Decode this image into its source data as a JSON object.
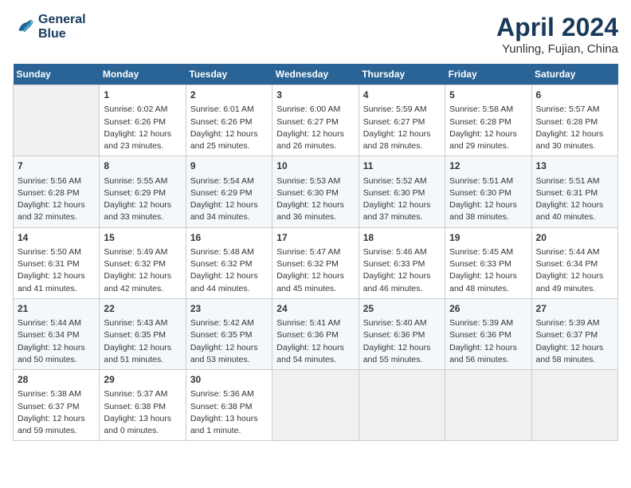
{
  "header": {
    "logo_line1": "General",
    "logo_line2": "Blue",
    "month": "April 2024",
    "location": "Yunling, Fujian, China"
  },
  "days_of_week": [
    "Sunday",
    "Monday",
    "Tuesday",
    "Wednesday",
    "Thursday",
    "Friday",
    "Saturday"
  ],
  "weeks": [
    [
      {
        "day": "",
        "empty": true
      },
      {
        "day": "1",
        "sunrise": "Sunrise: 6:02 AM",
        "sunset": "Sunset: 6:26 PM",
        "daylight": "Daylight: 12 hours and 23 minutes."
      },
      {
        "day": "2",
        "sunrise": "Sunrise: 6:01 AM",
        "sunset": "Sunset: 6:26 PM",
        "daylight": "Daylight: 12 hours and 25 minutes."
      },
      {
        "day": "3",
        "sunrise": "Sunrise: 6:00 AM",
        "sunset": "Sunset: 6:27 PM",
        "daylight": "Daylight: 12 hours and 26 minutes."
      },
      {
        "day": "4",
        "sunrise": "Sunrise: 5:59 AM",
        "sunset": "Sunset: 6:27 PM",
        "daylight": "Daylight: 12 hours and 28 minutes."
      },
      {
        "day": "5",
        "sunrise": "Sunrise: 5:58 AM",
        "sunset": "Sunset: 6:28 PM",
        "daylight": "Daylight: 12 hours and 29 minutes."
      },
      {
        "day": "6",
        "sunrise": "Sunrise: 5:57 AM",
        "sunset": "Sunset: 6:28 PM",
        "daylight": "Daylight: 12 hours and 30 minutes."
      }
    ],
    [
      {
        "day": "7",
        "sunrise": "Sunrise: 5:56 AM",
        "sunset": "Sunset: 6:28 PM",
        "daylight": "Daylight: 12 hours and 32 minutes."
      },
      {
        "day": "8",
        "sunrise": "Sunrise: 5:55 AM",
        "sunset": "Sunset: 6:29 PM",
        "daylight": "Daylight: 12 hours and 33 minutes."
      },
      {
        "day": "9",
        "sunrise": "Sunrise: 5:54 AM",
        "sunset": "Sunset: 6:29 PM",
        "daylight": "Daylight: 12 hours and 34 minutes."
      },
      {
        "day": "10",
        "sunrise": "Sunrise: 5:53 AM",
        "sunset": "Sunset: 6:30 PM",
        "daylight": "Daylight: 12 hours and 36 minutes."
      },
      {
        "day": "11",
        "sunrise": "Sunrise: 5:52 AM",
        "sunset": "Sunset: 6:30 PM",
        "daylight": "Daylight: 12 hours and 37 minutes."
      },
      {
        "day": "12",
        "sunrise": "Sunrise: 5:51 AM",
        "sunset": "Sunset: 6:30 PM",
        "daylight": "Daylight: 12 hours and 38 minutes."
      },
      {
        "day": "13",
        "sunrise": "Sunrise: 5:51 AM",
        "sunset": "Sunset: 6:31 PM",
        "daylight": "Daylight: 12 hours and 40 minutes."
      }
    ],
    [
      {
        "day": "14",
        "sunrise": "Sunrise: 5:50 AM",
        "sunset": "Sunset: 6:31 PM",
        "daylight": "Daylight: 12 hours and 41 minutes."
      },
      {
        "day": "15",
        "sunrise": "Sunrise: 5:49 AM",
        "sunset": "Sunset: 6:32 PM",
        "daylight": "Daylight: 12 hours and 42 minutes."
      },
      {
        "day": "16",
        "sunrise": "Sunrise: 5:48 AM",
        "sunset": "Sunset: 6:32 PM",
        "daylight": "Daylight: 12 hours and 44 minutes."
      },
      {
        "day": "17",
        "sunrise": "Sunrise: 5:47 AM",
        "sunset": "Sunset: 6:32 PM",
        "daylight": "Daylight: 12 hours and 45 minutes."
      },
      {
        "day": "18",
        "sunrise": "Sunrise: 5:46 AM",
        "sunset": "Sunset: 6:33 PM",
        "daylight": "Daylight: 12 hours and 46 minutes."
      },
      {
        "day": "19",
        "sunrise": "Sunrise: 5:45 AM",
        "sunset": "Sunset: 6:33 PM",
        "daylight": "Daylight: 12 hours and 48 minutes."
      },
      {
        "day": "20",
        "sunrise": "Sunrise: 5:44 AM",
        "sunset": "Sunset: 6:34 PM",
        "daylight": "Daylight: 12 hours and 49 minutes."
      }
    ],
    [
      {
        "day": "21",
        "sunrise": "Sunrise: 5:44 AM",
        "sunset": "Sunset: 6:34 PM",
        "daylight": "Daylight: 12 hours and 50 minutes."
      },
      {
        "day": "22",
        "sunrise": "Sunrise: 5:43 AM",
        "sunset": "Sunset: 6:35 PM",
        "daylight": "Daylight: 12 hours and 51 minutes."
      },
      {
        "day": "23",
        "sunrise": "Sunrise: 5:42 AM",
        "sunset": "Sunset: 6:35 PM",
        "daylight": "Daylight: 12 hours and 53 minutes."
      },
      {
        "day": "24",
        "sunrise": "Sunrise: 5:41 AM",
        "sunset": "Sunset: 6:36 PM",
        "daylight": "Daylight: 12 hours and 54 minutes."
      },
      {
        "day": "25",
        "sunrise": "Sunrise: 5:40 AM",
        "sunset": "Sunset: 6:36 PM",
        "daylight": "Daylight: 12 hours and 55 minutes."
      },
      {
        "day": "26",
        "sunrise": "Sunrise: 5:39 AM",
        "sunset": "Sunset: 6:36 PM",
        "daylight": "Daylight: 12 hours and 56 minutes."
      },
      {
        "day": "27",
        "sunrise": "Sunrise: 5:39 AM",
        "sunset": "Sunset: 6:37 PM",
        "daylight": "Daylight: 12 hours and 58 minutes."
      }
    ],
    [
      {
        "day": "28",
        "sunrise": "Sunrise: 5:38 AM",
        "sunset": "Sunset: 6:37 PM",
        "daylight": "Daylight: 12 hours and 59 minutes."
      },
      {
        "day": "29",
        "sunrise": "Sunrise: 5:37 AM",
        "sunset": "Sunset: 6:38 PM",
        "daylight": "Daylight: 13 hours and 0 minutes."
      },
      {
        "day": "30",
        "sunrise": "Sunrise: 5:36 AM",
        "sunset": "Sunset: 6:38 PM",
        "daylight": "Daylight: 13 hours and 1 minute."
      },
      {
        "day": "",
        "empty": true
      },
      {
        "day": "",
        "empty": true
      },
      {
        "day": "",
        "empty": true
      },
      {
        "day": "",
        "empty": true
      }
    ]
  ]
}
